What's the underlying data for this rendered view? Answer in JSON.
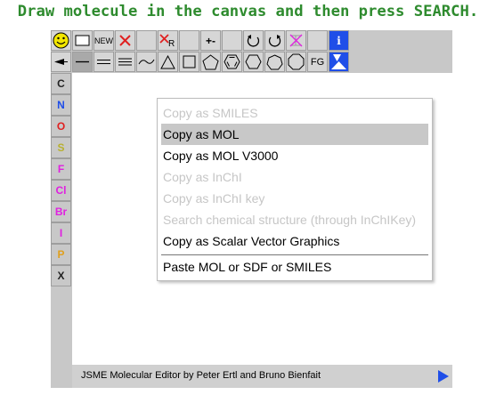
{
  "heading": "Draw molecule in the canvas and then press SEARCH.",
  "toolbar_top": {
    "new_label": "NEW",
    "charge_label": "+-",
    "info_label": "i"
  },
  "toolbar_bottom": {
    "fg_label": "FG"
  },
  "elements": [
    {
      "label": "C",
      "color": "#222222"
    },
    {
      "label": "N",
      "color": "#1f4ee8"
    },
    {
      "label": "O",
      "color": "#e02020"
    },
    {
      "label": "S",
      "color": "#b8b030"
    },
    {
      "label": "F",
      "color": "#e020e0"
    },
    {
      "label": "Cl",
      "color": "#e020e0"
    },
    {
      "label": "Br",
      "color": "#e020e0"
    },
    {
      "label": "I",
      "color": "#e020e0"
    },
    {
      "label": "P",
      "color": "#e0a020"
    },
    {
      "label": "X",
      "color": "#222222"
    }
  ],
  "context_menu": {
    "items": [
      {
        "label": "Copy as SMILES",
        "enabled": false
      },
      {
        "label": "Copy as MOL",
        "enabled": true,
        "highlighted": true
      },
      {
        "label": "Copy as MOL V3000",
        "enabled": true
      },
      {
        "label": "Copy as InChI",
        "enabled": false
      },
      {
        "label": "Copy as InChI key",
        "enabled": false
      },
      {
        "label": "Search chemical structure (through InChIKey)",
        "enabled": false
      },
      {
        "label": "Copy as Scalar Vector Graphics",
        "enabled": true
      }
    ],
    "paste_label": "Paste MOL or SDF or SMILES"
  },
  "status_text": "JSME Molecular Editor by Peter Ertl and Bruno Bienfait",
  "colors": {
    "heading": "#2e8b2e",
    "accent_blue": "#1f4ee8",
    "delete_red": "#e02020",
    "smiley_yellow": "#f2e600"
  }
}
